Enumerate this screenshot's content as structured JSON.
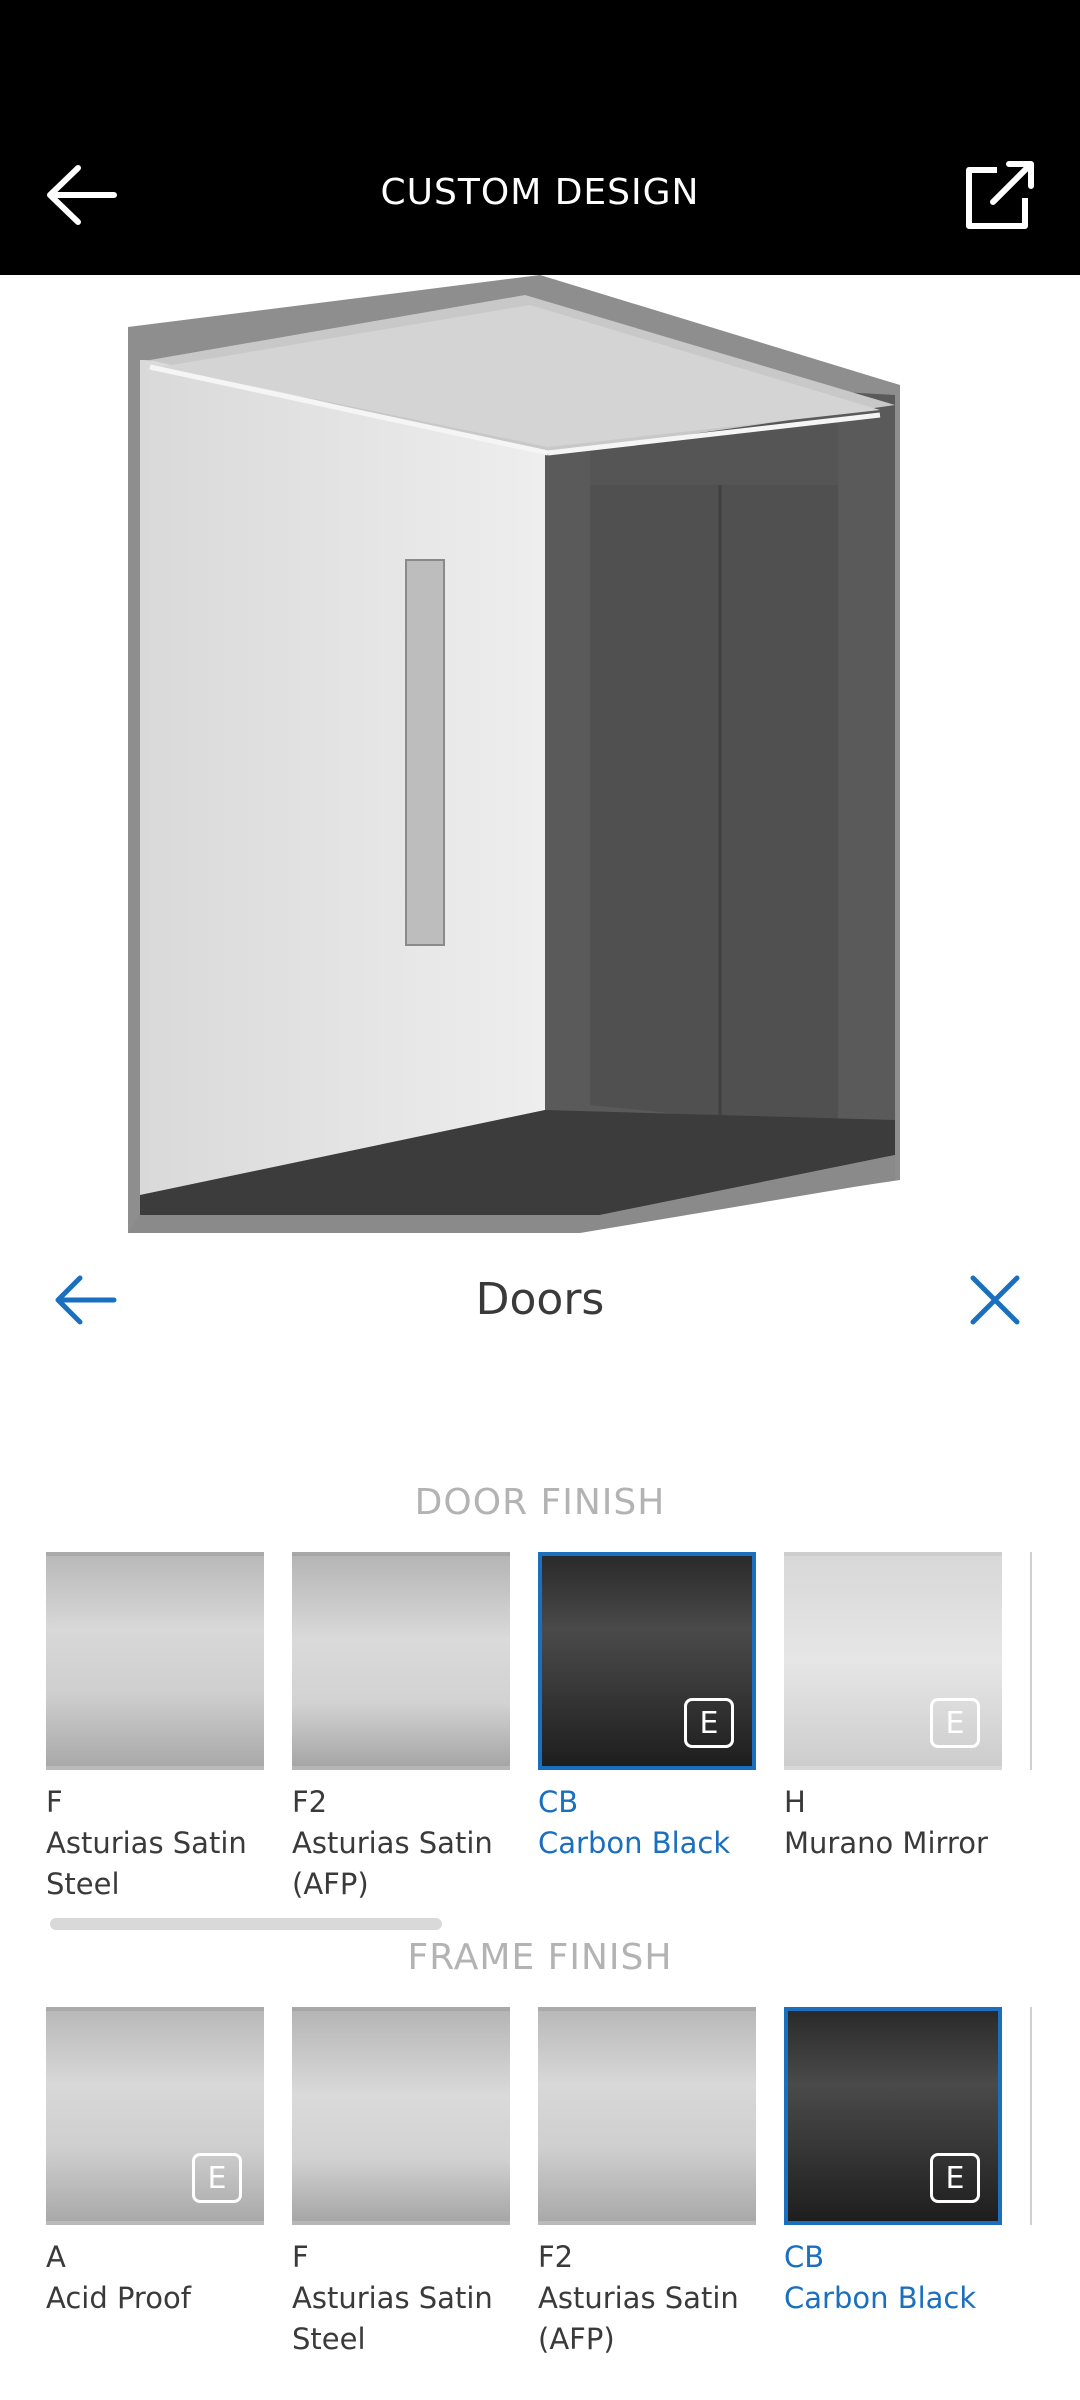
{
  "header": {
    "title": "CUSTOM DESIGN"
  },
  "panel": {
    "title": "Doors"
  },
  "door_finish": {
    "title": "DOOR FINISH",
    "items": [
      {
        "code": "F",
        "name": "Asturias Satin Steel",
        "selected": false,
        "badge": ""
      },
      {
        "code": "F2",
        "name": "Asturias Satin (AFP)",
        "selected": false,
        "badge": ""
      },
      {
        "code": "CB",
        "name": "Carbon Black",
        "selected": true,
        "badge": "E"
      },
      {
        "code": "H",
        "name": "Murano Mirror",
        "selected": false,
        "badge": "E"
      }
    ]
  },
  "frame_finish": {
    "title": "FRAME FINISH",
    "items": [
      {
        "code": "A",
        "name": "Acid Proof",
        "selected": false,
        "badge": "E"
      },
      {
        "code": "F",
        "name": "Asturias Satin Steel",
        "selected": false,
        "badge": ""
      },
      {
        "code": "F2",
        "name": "Asturias Satin (AFP)",
        "selected": false,
        "badge": ""
      },
      {
        "code": "CB",
        "name": "Carbon Black",
        "selected": true,
        "badge": "E"
      }
    ]
  },
  "colors": {
    "accent": "#1a6fbf",
    "topbar": "#000000"
  }
}
